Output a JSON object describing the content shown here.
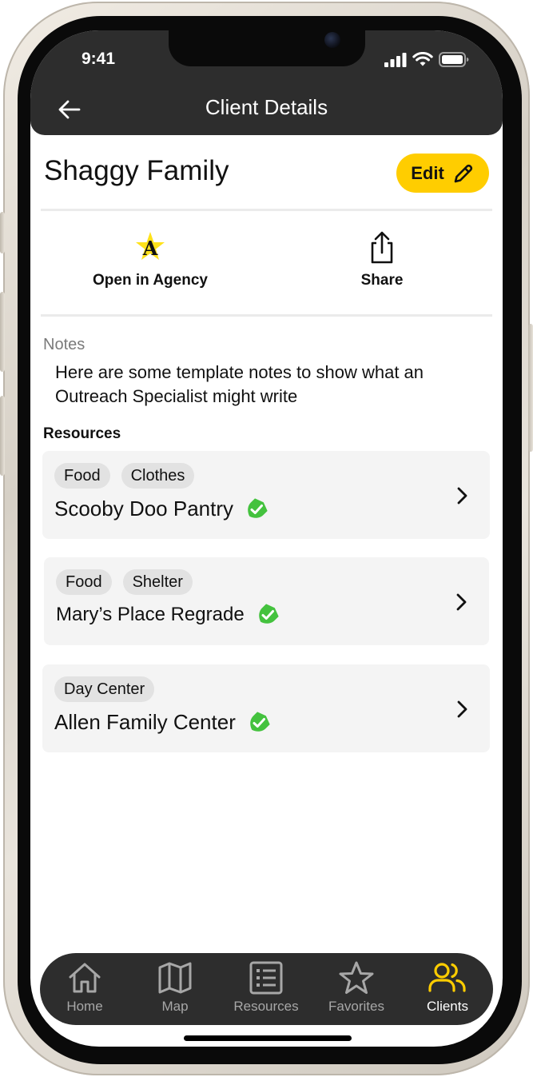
{
  "status_bar": {
    "time": "9:41"
  },
  "header": {
    "title": "Client Details"
  },
  "client": {
    "name": "Shaggy Family",
    "edit_label": "Edit"
  },
  "actions": {
    "open_in_agency": "Open in Agency",
    "agency_logo_letter": "A",
    "share": "Share"
  },
  "notes": {
    "label": "Notes",
    "text": "Here are some template notes to show what an Outreach Specialist might write"
  },
  "resources": {
    "label": "Resources",
    "items": [
      {
        "tags": [
          "Food",
          "Clothes"
        ],
        "title": "Scooby Doo Pantry",
        "verified": true
      },
      {
        "tags": [
          "Food",
          "Shelter"
        ],
        "title": "Mary’s Place Regrade",
        "verified": true
      },
      {
        "tags": [
          "Day Center"
        ],
        "title": "Allen Family Center",
        "verified": true
      }
    ]
  },
  "tabbar": {
    "items": [
      {
        "label": "Home",
        "icon": "home-icon"
      },
      {
        "label": "Map",
        "icon": "map-icon"
      },
      {
        "label": "Resources",
        "icon": "list-icon"
      },
      {
        "label": "Favorites",
        "icon": "star-icon"
      },
      {
        "label": "Clients",
        "icon": "users-icon"
      }
    ],
    "active": "Clients"
  },
  "colors": {
    "accent": "#ffcd00",
    "header_bg": "#2d2d2d",
    "verified": "#44c23e",
    "card_bg": "#f4f4f4"
  }
}
